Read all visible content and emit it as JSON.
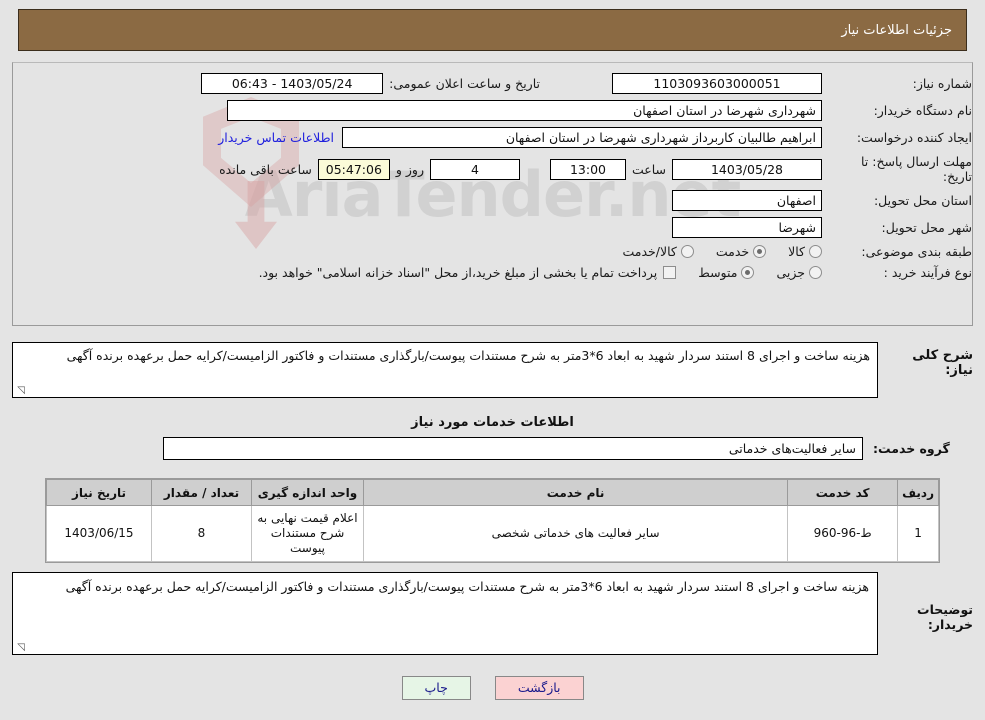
{
  "header": {
    "title": "جزئیات اطلاعات نیاز"
  },
  "watermark": {
    "text": "AriaTender.net"
  },
  "form": {
    "need_number": {
      "label": "شماره نیاز:",
      "value": "1103093603000051"
    },
    "announce_datetime": {
      "label": "تاریخ و ساعت اعلان عمومی:",
      "value": "1403/05/24 - 06:43"
    },
    "buyer_org": {
      "label": "نام دستگاه خریدار:",
      "value": "شهرداری شهرضا در استان اصفهان"
    },
    "requester": {
      "label": "ایجاد کننده درخواست:",
      "value": "ابراهیم طالبیان کاربرداز شهرداری شهرضا در استان اصفهان"
    },
    "contact_link": {
      "label": "اطلاعات تماس خریدار"
    },
    "deadline": {
      "label": "مهلت ارسال پاسخ: تا تاریخ:",
      "date": "1403/05/28",
      "time_label": "ساعت",
      "time": "13:00",
      "days": "4",
      "days_label": "روز و",
      "countdown": "05:47:06",
      "countdown_label": "ساعت باقی مانده"
    },
    "delivery_province": {
      "label": "استان محل تحویل:",
      "value": "اصفهان"
    },
    "delivery_city": {
      "label": "شهر محل تحویل:",
      "value": "شهرضا"
    },
    "category": {
      "label": "طبقه بندی موضوعی:",
      "options": [
        {
          "label": "کالا",
          "selected": false
        },
        {
          "label": "خدمت",
          "selected": true
        },
        {
          "label": "کالا/خدمت",
          "selected": false
        }
      ]
    },
    "purchase_type": {
      "label": "نوع فرآیند خرید :",
      "options": [
        {
          "label": "جزیی",
          "selected": false
        },
        {
          "label": "متوسط",
          "selected": true
        }
      ],
      "payment_note": "پرداخت تمام یا بخشی از مبلغ خرید،از محل \"اسناد خزانه اسلامی\" خواهد بود.",
      "payment_checked": false
    }
  },
  "general_description": {
    "label": "شرح کلی نیاز:",
    "value": "هزینه ساخت و اجرای 8 استند سردار شهید به ابعاد 6*3متر به شرح مستندات پیوست/بارگذاری مستندات و فاکتور الزامیست/کرایه حمل برعهده برنده آگهی"
  },
  "section_title": "اطلاعات خدمات مورد نیاز",
  "service_group": {
    "label": "گروه خدمت:",
    "value": "سایر فعالیت‌های خدماتی"
  },
  "items_table": {
    "columns": [
      "ردیف",
      "کد خدمت",
      "نام خدمت",
      "واحد اندازه گیری",
      "تعداد / مقدار",
      "تاریخ نیاز"
    ],
    "rows": [
      {
        "radif": "1",
        "code": "ط-96-960",
        "name": "سایر فعالیت های خدماتی شخصی",
        "unit": "اعلام قیمت نهایی به شرح مستندات پیوست",
        "quantity": "8",
        "need_date": "1403/06/15"
      }
    ]
  },
  "buyer_notes": {
    "label": "توضیحات خریدار:",
    "value": "هزینه ساخت و اجرای 8 استند سردار شهید به ابعاد 6*3متر به شرح مستندات پیوست/بارگذاری مستندات و فاکتور الزامیست/کرایه حمل برعهده برنده آگهی"
  },
  "footer": {
    "print_label": "چاپ",
    "back_label": "بازگشت"
  },
  "colors": {
    "header_bg": "#8b6a43",
    "page_bg": "#e4e4e4",
    "link": "#2020dd",
    "countdown_bg": "#fbfbd8",
    "print_bg": "#e6f5e6",
    "back_bg": "#fbd2d2"
  }
}
